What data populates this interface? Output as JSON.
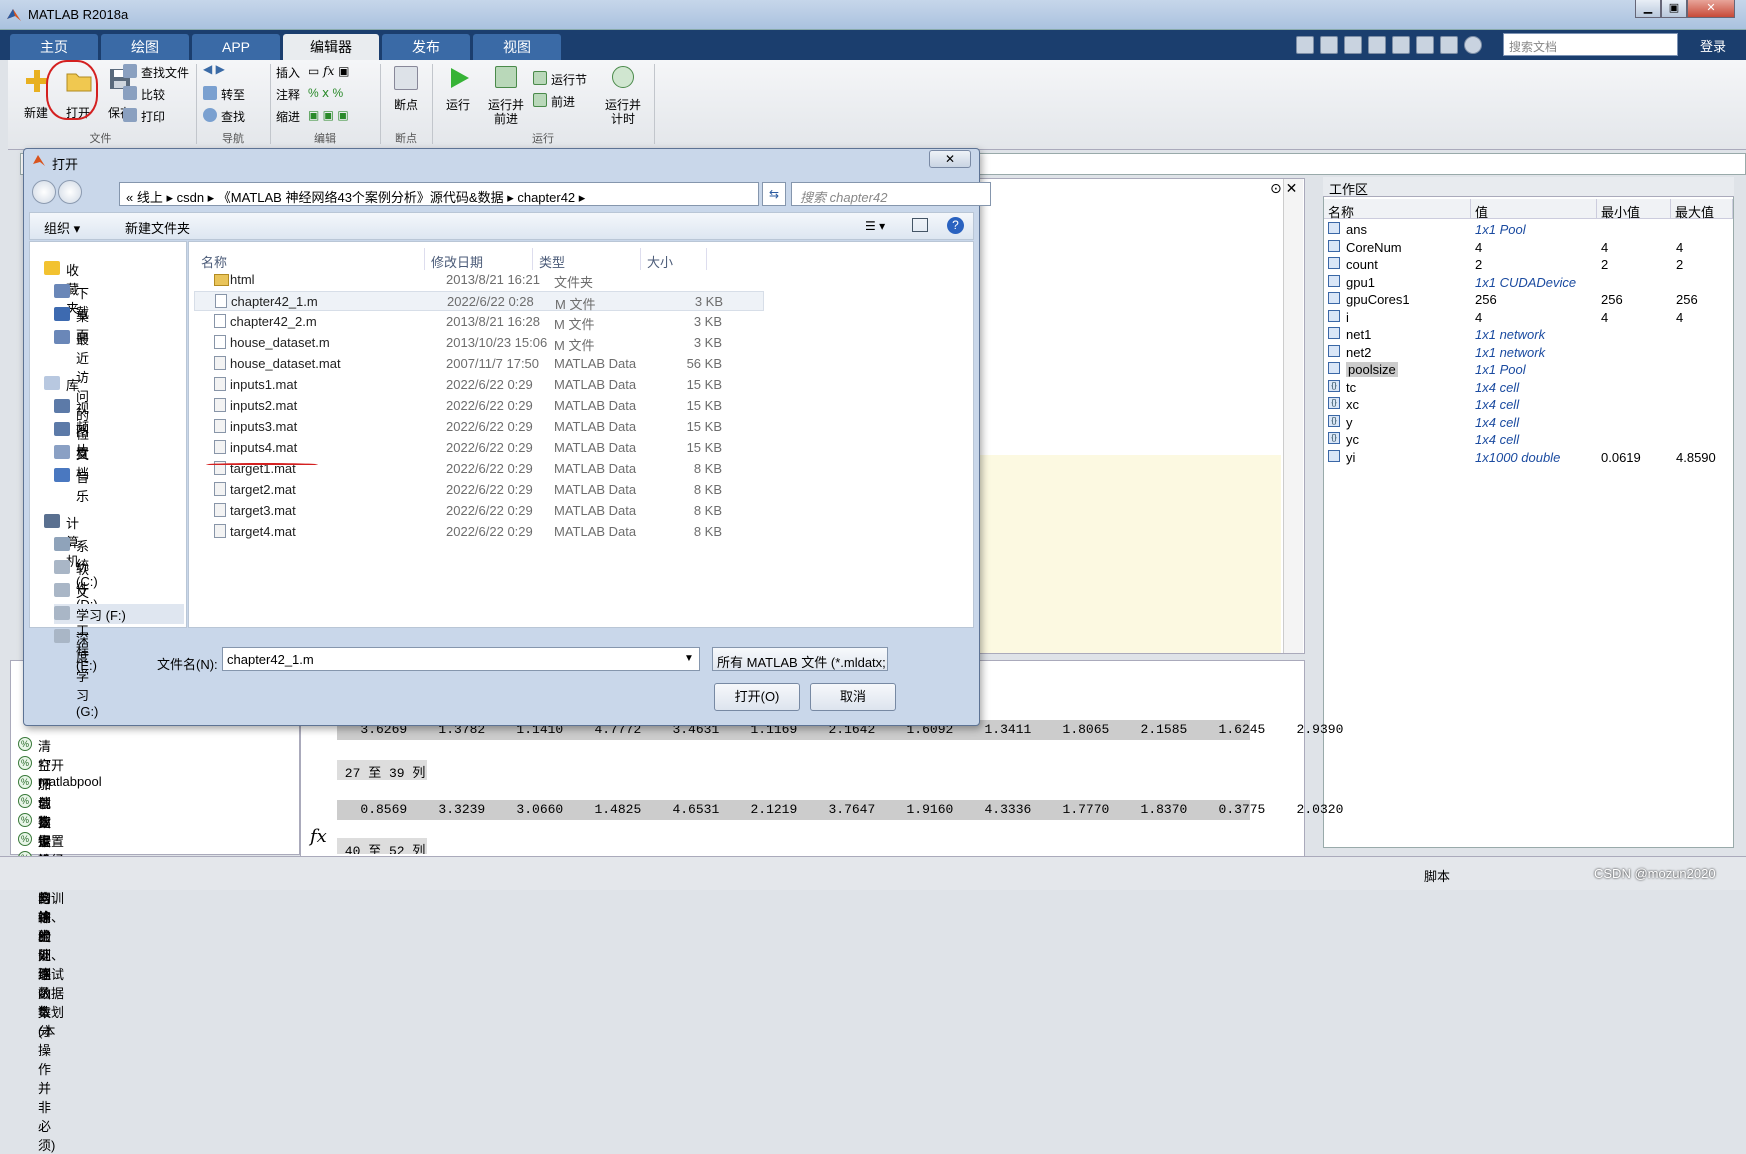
{
  "app": {
    "title": "MATLAB R2018a"
  },
  "tabs": [
    "主页",
    "绘图",
    "APP",
    "编辑器",
    "发布",
    "视图"
  ],
  "search_docs": {
    "placeholder": "搜索文档"
  },
  "login": "登录",
  "ribbon": {
    "new": "新建",
    "open": "打开",
    "save": "保存",
    "find_files": "查找文件",
    "compare": "比较",
    "print": "打印",
    "goto": "转至",
    "find": "查找",
    "insert": "插入",
    "comment": "注释",
    "indent": "缩进",
    "breakpoints": "断点",
    "run": "运行",
    "run_advance": [
      "运行并",
      "前进"
    ],
    "run_section": "运行节",
    "advance": "前进",
    "run_time": [
      "运行并",
      "计时"
    ],
    "groups": {
      "file": "文件",
      "navigate": "导航",
      "edit": "编辑",
      "breakpoints": "断点",
      "run": "运行"
    }
  },
  "workspace": {
    "title": "工作区",
    "columns": [
      "名称",
      "值",
      "最小值",
      "最大值"
    ],
    "vars": [
      {
        "name": "ans",
        "value": "1x1 Pool",
        "min": "",
        "max": "",
        "italic": true,
        "icon": "obj"
      },
      {
        "name": "CoreNum",
        "value": "4",
        "min": "4",
        "max": "4",
        "italic": false,
        "icon": "grid"
      },
      {
        "name": "count",
        "value": "2",
        "min": "2",
        "max": "2",
        "italic": false,
        "icon": "grid"
      },
      {
        "name": "gpu1",
        "value": "1x1 CUDADevice",
        "min": "",
        "max": "",
        "italic": true,
        "icon": "obj"
      },
      {
        "name": "gpuCores1",
        "value": "256",
        "min": "256",
        "max": "256",
        "italic": false,
        "icon": "grid"
      },
      {
        "name": "i",
        "value": "4",
        "min": "4",
        "max": "4",
        "italic": false,
        "icon": "grid"
      },
      {
        "name": "net1",
        "value": "1x1 network",
        "min": "",
        "max": "",
        "italic": true,
        "icon": "obj"
      },
      {
        "name": "net2",
        "value": "1x1 network",
        "min": "",
        "max": "",
        "italic": true,
        "icon": "obj"
      },
      {
        "name": "poolsize",
        "value": "1x1 Pool",
        "min": "",
        "max": "",
        "italic": true,
        "icon": "obj"
      },
      {
        "name": "tc",
        "value": "1x4 cell",
        "min": "",
        "max": "",
        "italic": true,
        "icon": "cell"
      },
      {
        "name": "xc",
        "value": "1x4 cell",
        "min": "",
        "max": "",
        "italic": true,
        "icon": "cell"
      },
      {
        "name": "y",
        "value": "1x4 cell",
        "min": "",
        "max": "",
        "italic": true,
        "icon": "cell"
      },
      {
        "name": "yc",
        "value": "1x4 cell",
        "min": "",
        "max": "",
        "italic": true,
        "icon": "cell"
      },
      {
        "name": "yi",
        "value": "1x1000 double",
        "min": "0.0619",
        "max": "4.8590",
        "italic": true,
        "icon": "grid"
      }
    ]
  },
  "cells": [
    "清空环境变量",
    "打开matlabpool",
    "加载数据",
    "创建一个拟合神经网络",
    "指定输入与输出处理函数(本操作并非必须)",
    "设置神经网络的训练、验证、测试数据集划分",
    "设置网络的训练函数"
  ],
  "command": {
    "row1": "   3.6269    1.3782    1.1410    4.7772    3.4631    1.1169    2.1642    1.6092    1.3411    1.8065    2.1585    1.6245    2.9390",
    "label1": " 27 至 39 列",
    "row2": "   0.8569    3.3239    3.0660    1.4825    4.6531    2.1219    3.7647    1.9160    4.3336    1.7770    1.8370    0.3775    2.0320",
    "label2": " 40 至 52 列",
    "fx": "fx"
  },
  "status": {
    "mode": "脚本",
    "watermark": "CSDN @mozun2020"
  },
  "dialog": {
    "title": "打开",
    "close": "✕",
    "address": "« 线上 ▸ csdn ▸ 《MATLAB 神经网络43个案例分析》源代码&数据 ▸ chapter42 ▸",
    "search_placeholder": "搜索 chapter42",
    "organize": "组织 ▾",
    "new_folder": "新建文件夹",
    "tree": [
      {
        "label": "收藏夹",
        "indent": 0,
        "color": "#f2c230"
      },
      {
        "label": "下载",
        "indent": 1,
        "color": "#6a87b8"
      },
      {
        "label": "桌面",
        "indent": 1,
        "color": "#3d6ab0"
      },
      {
        "label": "最近访问的位置",
        "indent": 1,
        "color": "#6a87b8"
      },
      {
        "label": "",
        "indent": 0,
        "color": ""
      },
      {
        "label": "库",
        "indent": 0,
        "color": "#b8c8e0"
      },
      {
        "label": "视频",
        "indent": 1,
        "color": "#5c7aa8"
      },
      {
        "label": "图片",
        "indent": 1,
        "color": "#5c7aa8"
      },
      {
        "label": "文档",
        "indent": 1,
        "color": "#8aa0c4"
      },
      {
        "label": "音乐",
        "indent": 1,
        "color": "#4a78c0"
      },
      {
        "label": "",
        "indent": 0,
        "color": ""
      },
      {
        "label": "计算机",
        "indent": 0,
        "color": "#5a7090"
      },
      {
        "label": "系统 (C:)",
        "indent": 1,
        "color": "#8fa3ba"
      },
      {
        "label": "软件 (D:)",
        "indent": 1,
        "color": "#a9b6c6"
      },
      {
        "label": "文档/工程 (E:)",
        "indent": 1,
        "color": "#a9b6c6"
      },
      {
        "label": "学习 (F:)",
        "indent": 1,
        "color": "#a9b6c6"
      },
      {
        "label": "深度学习 (G:)",
        "indent": 1,
        "color": "#a9b6c6"
      }
    ],
    "columns": [
      "名称",
      "修改日期",
      "类型",
      "大小"
    ],
    "files": [
      {
        "name": "html",
        "date": "2013/8/21 16:21",
        "type": "文件夹",
        "size": "",
        "kind": "folder"
      },
      {
        "name": "chapter42_1.m",
        "date": "2022/6/22 0:28",
        "type": "M 文件",
        "size": "3 KB",
        "kind": "m"
      },
      {
        "name": "chapter42_2.m",
        "date": "2013/8/21 16:28",
        "type": "M 文件",
        "size": "3 KB",
        "kind": "m"
      },
      {
        "name": "house_dataset.m",
        "date": "2013/10/23 15:06",
        "type": "M 文件",
        "size": "3 KB",
        "kind": "m"
      },
      {
        "name": "house_dataset.mat",
        "date": "2007/11/7 17:50",
        "type": "MATLAB Data",
        "size": "56 KB",
        "kind": "mat"
      },
      {
        "name": "inputs1.mat",
        "date": "2022/6/22 0:29",
        "type": "MATLAB Data",
        "size": "15 KB",
        "kind": "mat"
      },
      {
        "name": "inputs2.mat",
        "date": "2022/6/22 0:29",
        "type": "MATLAB Data",
        "size": "15 KB",
        "kind": "mat"
      },
      {
        "name": "inputs3.mat",
        "date": "2022/6/22 0:29",
        "type": "MATLAB Data",
        "size": "15 KB",
        "kind": "mat"
      },
      {
        "name": "inputs4.mat",
        "date": "2022/6/22 0:29",
        "type": "MATLAB Data",
        "size": "15 KB",
        "kind": "mat"
      },
      {
        "name": "target1.mat",
        "date": "2022/6/22 0:29",
        "type": "MATLAB Data",
        "size": "8 KB",
        "kind": "mat"
      },
      {
        "name": "target2.mat",
        "date": "2022/6/22 0:29",
        "type": "MATLAB Data",
        "size": "8 KB",
        "kind": "mat"
      },
      {
        "name": "target3.mat",
        "date": "2022/6/22 0:29",
        "type": "MATLAB Data",
        "size": "8 KB",
        "kind": "mat"
      },
      {
        "name": "target4.mat",
        "date": "2022/6/22 0:29",
        "type": "MATLAB Data",
        "size": "8 KB",
        "kind": "mat"
      }
    ],
    "filename_label": "文件名(N):",
    "filename": "chapter42_1.m",
    "filetype": "所有 MATLAB 文件 (*.mldatx;",
    "open_btn": "打开(O)",
    "cancel_btn": "取消"
  }
}
